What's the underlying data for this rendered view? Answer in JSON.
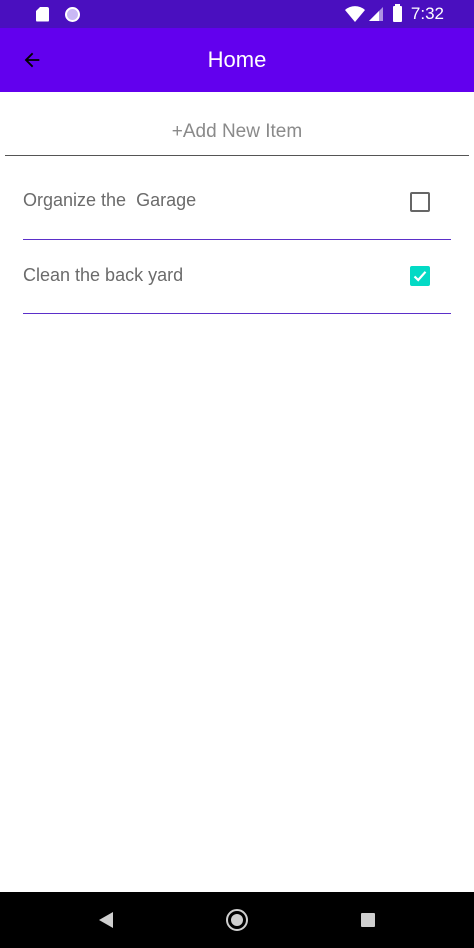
{
  "status_bar": {
    "time": "7:32",
    "icons": [
      "sd-card-icon",
      "circle-notification-icon",
      "wifi-icon",
      "cell-signal-icon",
      "battery-icon"
    ]
  },
  "app_bar": {
    "title": "Home",
    "back_icon": "arrow-left-icon"
  },
  "add_item": {
    "label": "+Add New Item"
  },
  "todo_list": {
    "items": [
      {
        "label": "Organize the  Garage",
        "checked": false
      },
      {
        "label": "Clean the back yard",
        "checked": true
      }
    ]
  },
  "nav_bar": {
    "icons": [
      "nav-back-icon",
      "nav-home-icon",
      "nav-recents-icon"
    ]
  },
  "colors": {
    "status_bar": "#4a0fbf",
    "app_bar": "#6200ee",
    "accent_checkbox": "#03dac5",
    "divider": "#5b2fc9"
  }
}
